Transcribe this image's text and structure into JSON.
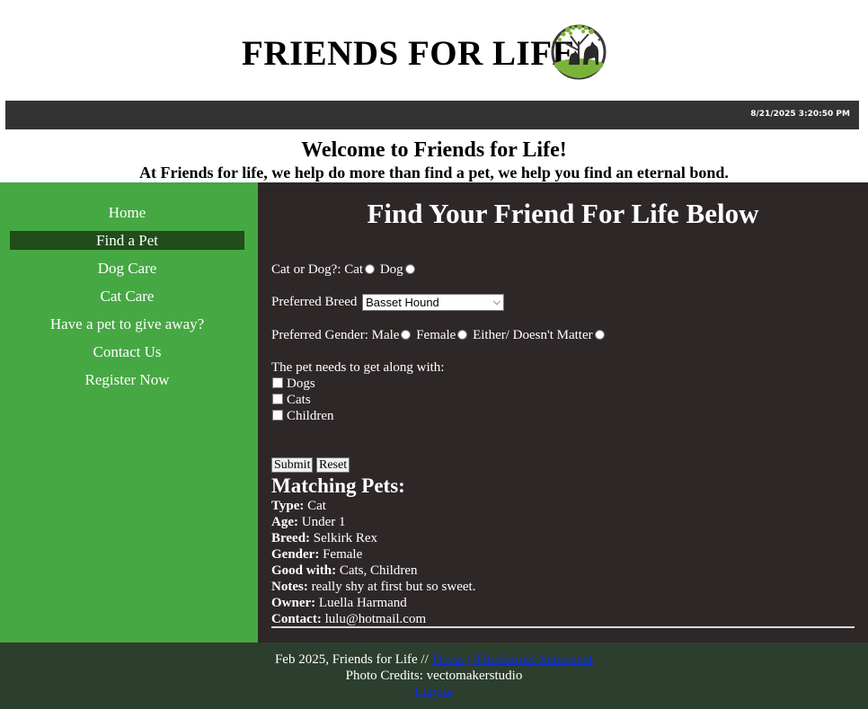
{
  "header": {
    "site_title": "FRIENDS FOR LIFE",
    "logo_icon": "pet-tree-logo-icon",
    "datetime": "8/21/2025 3:20:50 PM"
  },
  "intro": {
    "welcome": "Welcome to Friends for Life!",
    "tagline": "At Friends for life, we help do more than find a pet, we help you find an eternal bond."
  },
  "nav": {
    "items": [
      {
        "label": "Home",
        "active": false
      },
      {
        "label": "Find a Pet",
        "active": true
      },
      {
        "label": "Dog Care",
        "active": false
      },
      {
        "label": "Cat Care",
        "active": false
      },
      {
        "label": "Have a pet to give away?",
        "active": false
      },
      {
        "label": "Contact Us",
        "active": false
      },
      {
        "label": "Register Now",
        "active": false
      }
    ]
  },
  "main": {
    "heading": "Find Your Friend For Life Below",
    "form": {
      "type_label": "Cat or Dog?:",
      "type_options": [
        "Cat",
        "Dog"
      ],
      "breed_label": "Preferred Breed",
      "breed_value": "Basset Hound",
      "gender_label": "Preferred Gender:",
      "gender_options": [
        "Male",
        "Female",
        "Either/ Doesn't Matter"
      ],
      "along_label": "The pet needs to get along with:",
      "along_options": [
        "Dogs",
        "Cats",
        "Children"
      ],
      "submit_label": "Submit",
      "reset_label": "Reset"
    },
    "matches": {
      "heading": "Matching Pets:",
      "fields": [
        {
          "label": "Type:",
          "value": "Cat"
        },
        {
          "label": "Age:",
          "value": "Under 1"
        },
        {
          "label": "Breed:",
          "value": "Selkirk Rex"
        },
        {
          "label": "Gender:",
          "value": "Female"
        },
        {
          "label": "Good with:",
          "value": "Cats, Children"
        },
        {
          "label": "Notes:",
          "value": "really shy at first but so sweet."
        },
        {
          "label": "Owner:",
          "value": "Luella Harmand"
        },
        {
          "label": "Contact:",
          "value": "lulu@hotmail.com"
        }
      ]
    }
  },
  "footer": {
    "copyright": "Feb 2025, Friends for Life //",
    "privacy_link": "Privacy/Disclaimer Statement",
    "credits": "Photo Credits: vectomakerstudio",
    "logout_link": "Logout"
  },
  "colors": {
    "sidebar": "#46a843",
    "sidebar_active": "#204d19",
    "main_bg": "#2e2728",
    "date_bar": "#333333",
    "footer_bg": "#2c3e2d",
    "link": "#0b2bd6"
  }
}
